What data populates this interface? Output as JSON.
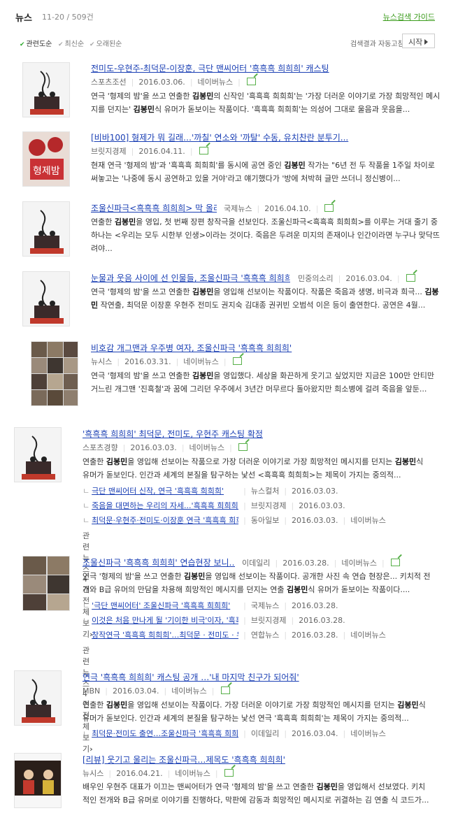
{
  "header": {
    "title": "뉴스",
    "count": "11-20 / 509건",
    "guide": "뉴스검색 가이드"
  },
  "sort": {
    "options": [
      "관련도순",
      "최신순",
      "오래된순"
    ],
    "auto_refresh_label": "검색결과 자동고침",
    "start_label": "시작"
  },
  "items": [
    {
      "title": "전미도-우현주-최덕문-이장훈, 극단 맨씨어터 '흑흑흑 희희희' 캐스팅",
      "source": "스포츠조선",
      "date": "2016.03.06.",
      "extra": "네이버뉴스",
      "desc_pre1": "연극 '형제의 밤'을 쓰고 연출한 ",
      "desc_b1": "김봉민",
      "desc_post1": "의 신작인 '흑흑흑 희희희'는 '가장 더러운 이야기로 가장 희망적인 메시지를 던지는' ",
      "desc_b2": "김봉민",
      "desc_post2": "식 유머가 돋보이는 작품이다. '흑흑흑 희희희'는 의성어 그대로 울음과 웃음을..."
    },
    {
      "title": "[비바100] 형제가 뭐 길래…'까칠' 연소와 '까탈' 수동, 유치찬란 분투기...",
      "source": "브릿지경제",
      "date": "2016.04.11.",
      "desc_pre1": "현재 연극 '형제의 밤'과 '흑흑흑 희희희'를 동시에 공연 중인 ",
      "desc_b1": "김봉민",
      "desc_post1": " 작가는 \"6년 전 두 작품을 1주일 차이로 써놓고는 '나중에 동시 공연하고 있을 거야'라고 얘기했다가 '방에 처박혀 글만 쓰더니 정신병이..."
    },
    {
      "title": "조울신파극<흑흑흑 희희희> 막 올라",
      "source": "국제뉴스",
      "date": "2016.04.10.",
      "desc_pre1": "연출한 ",
      "desc_b1": "김봉민",
      "desc_post1": "을 영입, 첫 번째 장편 창작극을 선보인다. 조울신파극<흑흑흑 희희희>를 이루는 거대 줄기 중 하나는 <우리는 모두 시한부 인생>이라는 것이다. 죽음은 두려운 미지의 존재이나 인간이라면 누구나 맞닥뜨려야..."
    },
    {
      "title": "눈물과 웃음 사이에 선 인물들, 조울신파극 '흑흑흑 희희희'",
      "source": "민중의소리",
      "date": "2016.03.04.",
      "desc_pre1": "연극 '형제의 밤'을 쓰고 연출한 ",
      "desc_b1": "김봉민",
      "desc_post1": "을 영입해 선보이는 작품이다. 작품은 죽음과 생명, 비극과 희극... ",
      "desc_b2": "김봉민",
      "desc_post2": " 작연출, 최덕문 이장훈 우현주 전미도 권지숙 김대종 권귀빈 오범석 이은 등이 출연한다. 공연은 4월..."
    },
    {
      "title": "비호감 개그맨과 우주병 여자, 조울신파극 '흑흑흑 희희희'",
      "source": "뉴시스",
      "date": "2016.03.31.",
      "extra": "네이버뉴스",
      "desc_pre1": "연극 '형제의 밤'을 쓰고 연출한 ",
      "desc_b1": "김봉민",
      "desc_post1": "을 영입했다. 세상을 화끈하게 웃기고 싶었지만 지금은 100만 안티만 거느린 개그맨 '진흑철'과 꿈에 그리던 우주에서 3년간 머무르다 돌아왔지만 희소병에 걸려 죽음을 앞둔..."
    },
    {
      "title": "'흑흑흑 희희희' 최덕문, 전미도, 우현주 캐스팅 확정",
      "source": "스포츠경향",
      "date": "2016.03.03.",
      "extra": "네이버뉴스",
      "desc_pre1": "연출한 ",
      "desc_b1": "김봉민",
      "desc_post1": "을 영입해 선보이는 작품으로 가장 더러운 이야기로 가장 희망적인 메시지를 던지는 ",
      "desc_b2": "김봉민",
      "desc_post2": "식 유머가 돋보인다. 인간과 세계의 본질을 탐구하는 낯선 <흑흑흑 희희희>는 제목이 가지는 중의적...",
      "related": [
        {
          "title": "극단 맨씨어터 신작, 연극 '흑흑흑 희희희'",
          "source": "뉴스컬처",
          "date": "2016.03.03."
        },
        {
          "title": "죽음을 대면하는 우리의 자세...'흑흑흑 희희희'",
          "source": "브릿지경제",
          "date": "2016.03.03."
        },
        {
          "title": "최덕문·우현주·전미도·이장훈 연극 '흑흑흑 희희희'",
          "source": "동아일보",
          "date": "2016.03.03.",
          "extra": "네이버뉴스"
        }
      ],
      "more": "관련뉴스 4건 전체보기"
    },
    {
      "title": "조울신파극 '흑흑흑 희희희' 연습현장 보니…",
      "source": "이데일리",
      "date": "2016.03.28.",
      "extra": "네이버뉴스",
      "desc_pre1": "연극 '형제의 밤'을 쓰고 연출한 ",
      "desc_b1": "김봉민",
      "desc_post1": "을 영입해 선보이는 작품이다. 공개한 사진 속 연습 현장은... 키치적 전개와 B급 유머의 만담을 차용해 희망적인 메시지를 던지는 연출 ",
      "desc_b2": "김봉민",
      "desc_post2": "식 유머가 돋보이는 작품이다....",
      "related": [
        {
          "title": "'극단 맨씨어터' 조울신파극 '흑흑흑 희희희'",
          "source": "국제뉴스",
          "date": "2016.03.28."
        },
        {
          "title": "이것은 처음 만나게 될 '기이한 비극'이자, '흑흑흑 희희희'",
          "source": "브릿지경제",
          "date": "2016.03.28."
        },
        {
          "title": "창작연극 '흑흑흑 희희희'…최덕문 · 전미도 · 우현주",
          "source": "연합뉴스",
          "date": "2016.03.28.",
          "extra": "네이버뉴스"
        }
      ],
      "more": "관련뉴스 4건 전체보기"
    },
    {
      "title": "연극 '흑흑흑 희희희' 캐스팅 공개 …'내 마지막 친구가 되어줘'",
      "source": "MBN",
      "date": "2016.03.04.",
      "extra": "네이버뉴스",
      "desc_pre1": "연출한 ",
      "desc_b1": "김봉민",
      "desc_post1": "을 영입해 선보이는 작품이다. 가장 더러운 이야기로 가장 희망적인 메시지를 던지는 ",
      "desc_b2": "김봉민",
      "desc_post2": "식 유머가 돋보인다. 인간과 세계의 본질을 탐구하는 낯선 연극 '흑흑흑 희희희'는 제목이 가지는 중의적...",
      "related": [
        {
          "title": "최덕문·전미도 출연…조울신파극 '흑흑흑 희희희'",
          "source": "이데일리",
          "date": "2016.03.04.",
          "extra": "네이버뉴스"
        }
      ]
    },
    {
      "title": "[리뷰] 웃기고 울리는 조울신파극…제목도 '흑흑흑 희희희'",
      "source": "뉴시스",
      "date": "2016.04.21.",
      "extra": "네이버뉴스",
      "desc_pre1": "배우인 우현주 대표가 이끄는 맨씨어터가 연극 '형제의 밤'을 쓰고 연출한 ",
      "desc_b1": "김봉민",
      "desc_post1": "을 영입해서 선보였다. 키치적인 전개와 B급 유머로 이야기를 진행하다, 막판에 감동과 희망적인 메시지로 귀결하는 김 연출 식 코드가..."
    }
  ],
  "colors": {
    "link": "#1a3fb4",
    "accent_green": "#3a9b1b",
    "meta": "#666666"
  },
  "icons": {
    "external": "external-link-icon",
    "check": "check-icon",
    "play": "play-triangle-icon",
    "chevron": "chevron-right-icon"
  }
}
